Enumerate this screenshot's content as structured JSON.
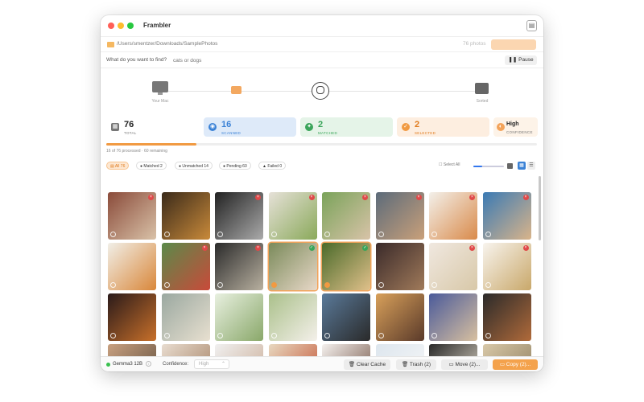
{
  "app": {
    "title": "Frambler"
  },
  "path": {
    "text": "/Users/smentzer/Downloads/SamplePhotos",
    "count": "76 photos",
    "button": ""
  },
  "query": {
    "label": "What do you want to find?",
    "placeholder": "cats or dogs",
    "pause": "Pause"
  },
  "flow": {
    "source_label": "Your Mac",
    "dest_label": "Sorted"
  },
  "stats": {
    "total": {
      "value": "76",
      "label": "TOTAL"
    },
    "scanned": {
      "value": "16",
      "label": "SCANNED"
    },
    "matched": {
      "value": "2",
      "label": "MATCHED"
    },
    "selected": {
      "value": "2",
      "label": "SELECTED"
    },
    "confidence": {
      "value": "High",
      "label": "CONFIDENCE"
    }
  },
  "progress": {
    "fraction": 0.21,
    "text": "16 of 76 processed · 60 remaining"
  },
  "filters": {
    "all": "All 76",
    "matched": "Matched 2",
    "unmatched": "Unmatched 14",
    "pending": "Pending 60",
    "failed": "Failed 0",
    "select_all": "Select All"
  },
  "zoom": {
    "fraction": 0.3
  },
  "colors": {
    "accent": "#f19a42",
    "blue": "#3b82d6",
    "green": "#3aa55a",
    "red": "#e04848"
  },
  "grid": [
    {
      "status": "unmatched",
      "selected": false
    },
    {
      "status": "pending",
      "selected": false
    },
    {
      "status": "unmatched",
      "selected": false
    },
    {
      "status": "unmatched",
      "selected": false
    },
    {
      "status": "unmatched",
      "selected": false
    },
    {
      "status": "unmatched",
      "selected": false
    },
    {
      "status": "unmatched",
      "selected": false
    },
    {
      "status": "unmatched",
      "selected": false
    },
    {
      "status": "pending",
      "selected": false
    },
    {
      "status": "unmatched",
      "selected": false
    },
    {
      "status": "unmatched",
      "selected": false
    },
    {
      "status": "matched",
      "selected": true
    },
    {
      "status": "matched",
      "selected": true
    },
    {
      "status": "pending",
      "selected": false
    },
    {
      "status": "unmatched",
      "selected": false
    },
    {
      "status": "unmatched",
      "selected": false
    },
    {
      "status": "pending",
      "selected": false
    },
    {
      "status": "pending",
      "selected": false
    },
    {
      "status": "pending",
      "selected": false
    },
    {
      "status": "pending",
      "selected": false
    },
    {
      "status": "pending",
      "selected": false
    },
    {
      "status": "pending",
      "selected": false
    },
    {
      "status": "pending",
      "selected": false
    },
    {
      "status": "pending",
      "selected": false
    },
    {
      "status": "pending",
      "selected": false
    },
    {
      "status": "pending",
      "selected": false
    },
    {
      "status": "pending",
      "selected": false
    },
    {
      "status": "pending",
      "selected": false
    },
    {
      "status": "pending",
      "selected": false
    },
    {
      "status": "pending",
      "selected": false
    },
    {
      "status": "pending",
      "selected": false
    },
    {
      "status": "pending",
      "selected": false
    }
  ],
  "bottom": {
    "model": "Gemma3 12B",
    "confidence_label": "Confidence:",
    "confidence_value": "High",
    "clear_cache": "Clear Cache",
    "trash": "Trash (2)",
    "move": "Move (2)...",
    "copy": "Copy (2)..."
  }
}
